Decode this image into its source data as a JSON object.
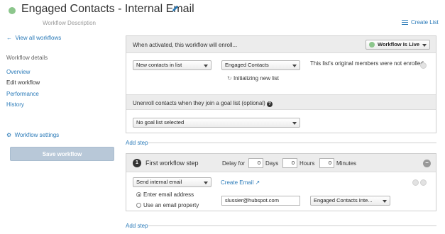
{
  "header": {
    "title": "Engaged Contacts - Internal Email",
    "description": "Workflow Description",
    "create_list": "Create List"
  },
  "sidebar": {
    "back_link": "View all workflows",
    "heading": "Workflow details",
    "items": [
      {
        "label": "Overview"
      },
      {
        "label": "Edit workflow"
      },
      {
        "label": "Performance"
      },
      {
        "label": "History"
      }
    ],
    "settings": "Workflow settings",
    "save": "Save workflow"
  },
  "enroll": {
    "header": "When activated, this workflow will enroll...",
    "live_button": "Workflow Is Live",
    "type_select": "New contacts in list",
    "list_select": "Engaged Contacts",
    "initializing": "Initializing new list",
    "note": "This list's original members were not enrolled"
  },
  "unenroll": {
    "header": "Unenroll contacts when they join a goal list (optional)",
    "select": "No goal list selected"
  },
  "add_step": "Add step",
  "step": {
    "number": "1",
    "title": "First workflow step",
    "delay_label": "Delay for",
    "days_value": "0",
    "days_label": "Days",
    "hours_value": "0",
    "hours_label": "Hours",
    "minutes_value": "0",
    "minutes_label": "Minutes",
    "action_select": "Send internal email",
    "create_email": "Create Email",
    "radio_enter": "Enter email address",
    "radio_property": "Use an email property",
    "email_value": "slussier@hubspot.com",
    "email_select": "Engaged Contacts Inte..."
  },
  "colors": {
    "link": "#2a7ab8",
    "live_dot": "#8cc68c",
    "save_disabled": "#b8c8d8"
  }
}
